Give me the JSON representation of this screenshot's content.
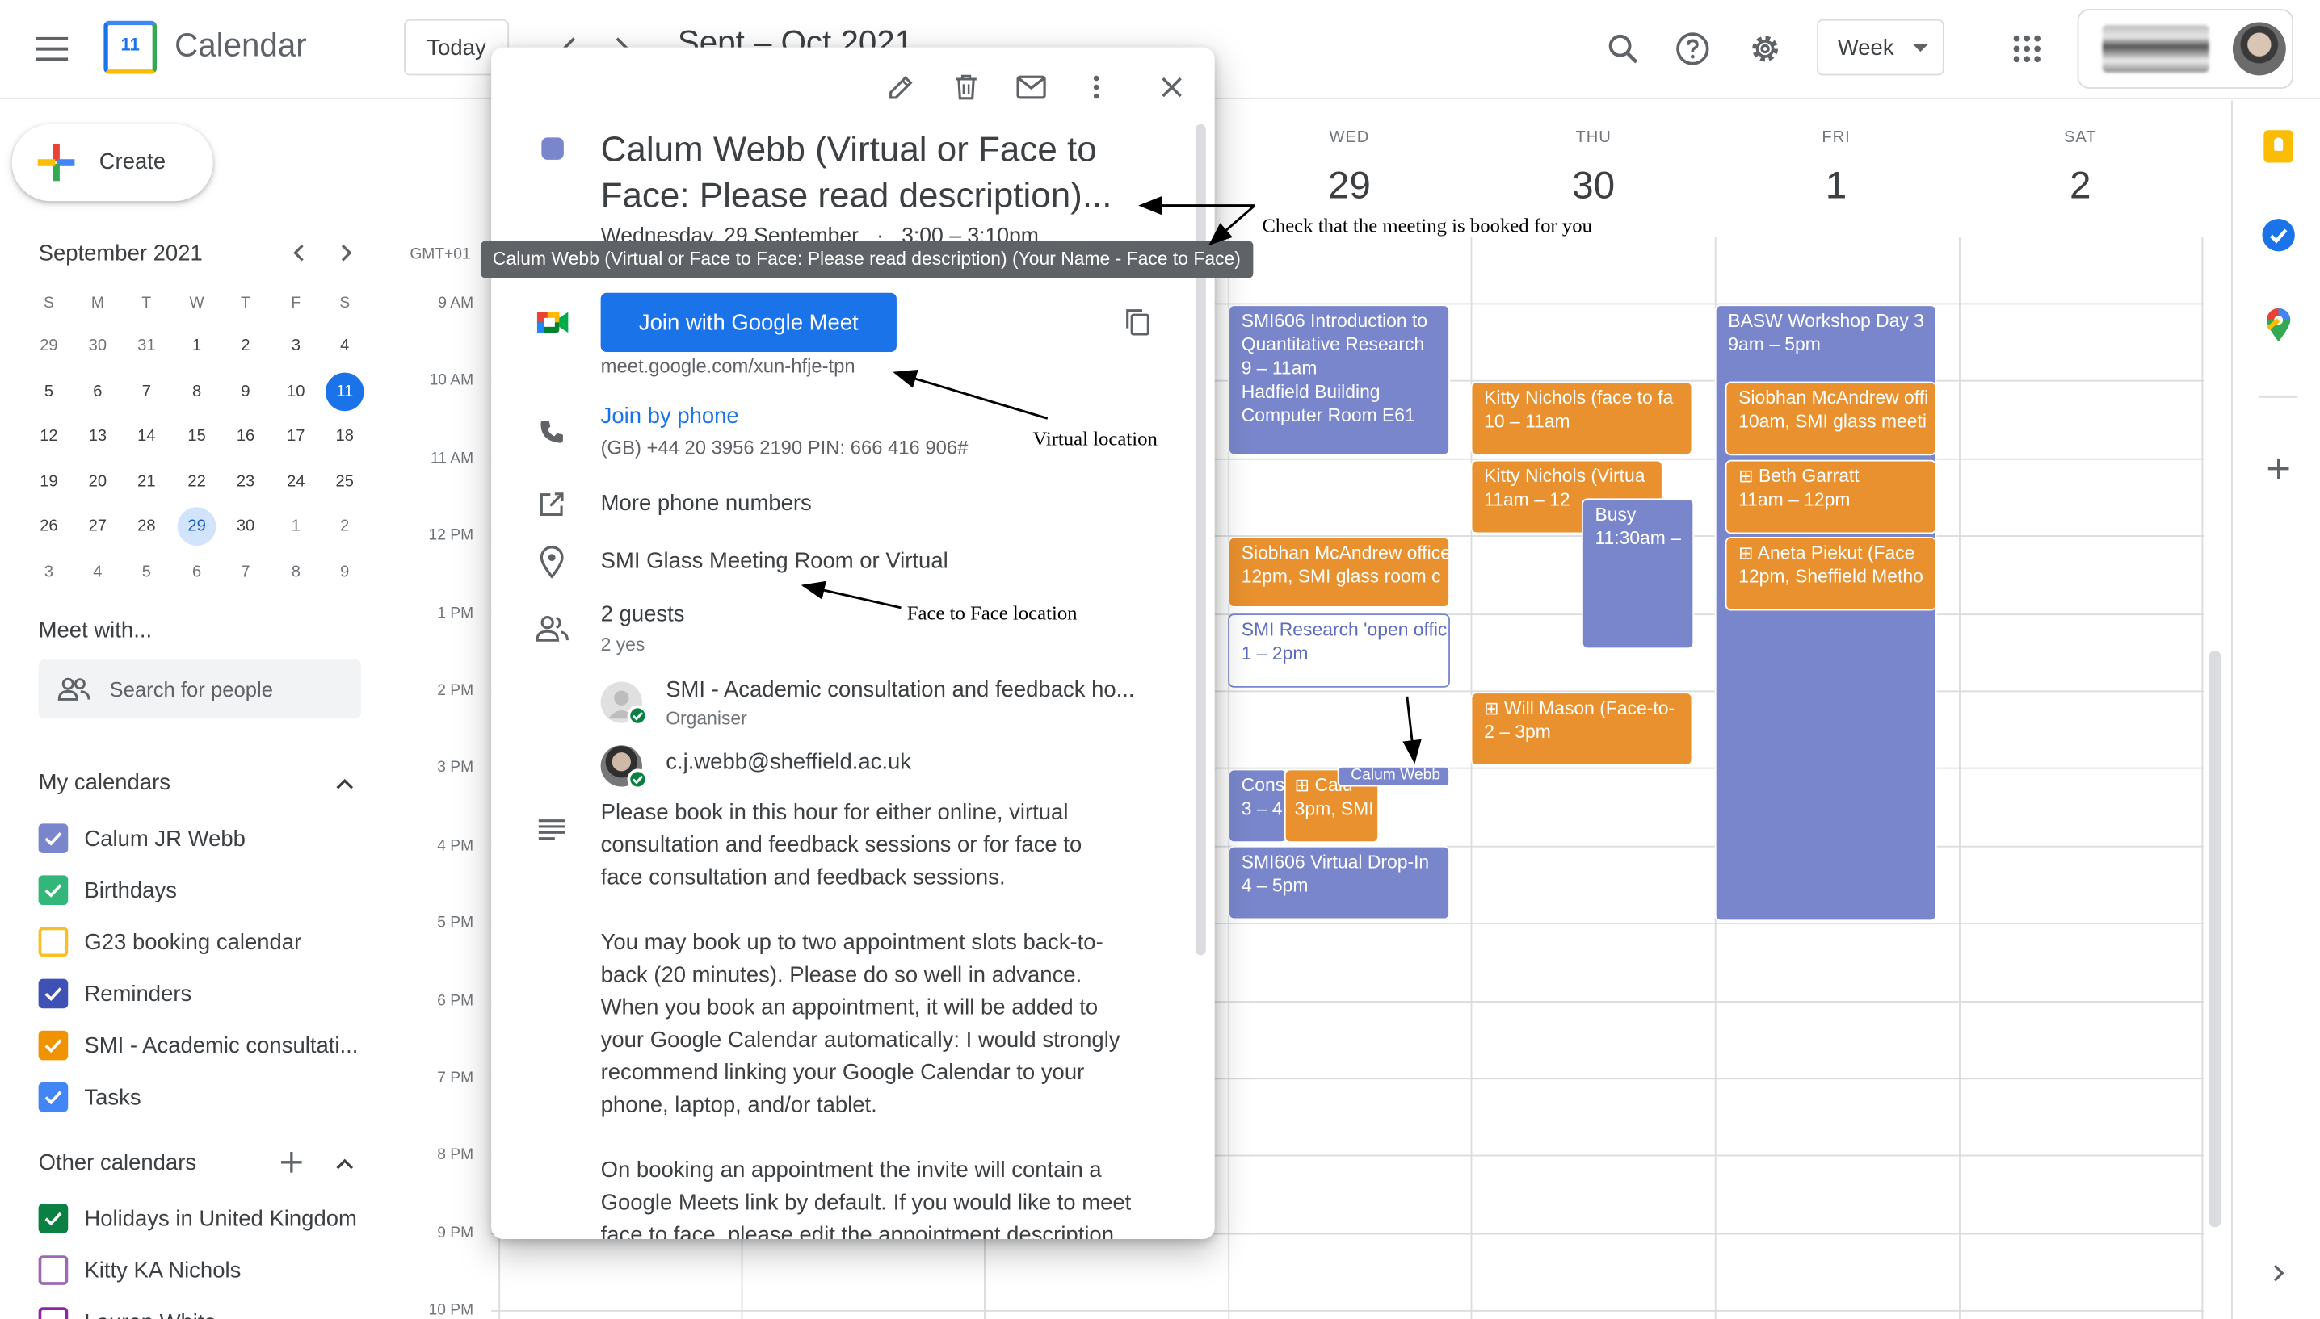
{
  "app": {
    "title": "Calendar",
    "logo_day": "11"
  },
  "header": {
    "today_label": "Today",
    "range_title": "Sept – Oct 2021",
    "view_label": "Week"
  },
  "sidebar": {
    "create_label": "Create",
    "mini_month": "September 2021",
    "weekdays": [
      "S",
      "M",
      "T",
      "W",
      "T",
      "F",
      "S"
    ],
    "weeks": [
      [
        "29",
        "30",
        "31",
        "1",
        "2",
        "3",
        "4"
      ],
      [
        "5",
        "6",
        "7",
        "8",
        "9",
        "10",
        "11"
      ],
      [
        "12",
        "13",
        "14",
        "15",
        "16",
        "17",
        "18"
      ],
      [
        "19",
        "20",
        "21",
        "22",
        "23",
        "24",
        "25"
      ],
      [
        "26",
        "27",
        "28",
        "29",
        "30",
        "1",
        "2"
      ],
      [
        "3",
        "4",
        "5",
        "6",
        "7",
        "8",
        "9"
      ]
    ],
    "today_date": "11",
    "selected_date": "29",
    "meet_with": "Meet with...",
    "search_people_placeholder": "Search for people",
    "my_calendars_label": "My calendars",
    "my_calendars": [
      {
        "name": "Calum JR Webb",
        "color": "#7986cb",
        "checked": true
      },
      {
        "name": "Birthdays",
        "color": "#33b679",
        "checked": true
      },
      {
        "name": "G23 booking calendar",
        "color": "#f6bf26",
        "checked": false
      },
      {
        "name": "Reminders",
        "color": "#3f51b5",
        "checked": true
      },
      {
        "name": "SMI - Academic consultati...",
        "color": "#f09300",
        "checked": true
      },
      {
        "name": "Tasks",
        "color": "#4285f4",
        "checked": true
      }
    ],
    "other_calendars_label": "Other calendars",
    "other_calendars": [
      {
        "name": "Holidays in United Kingdom",
        "color": "#0b8043",
        "checked": true
      },
      {
        "name": "Kitty KA Nichols",
        "color": "#9e69af",
        "checked": false
      },
      {
        "name": "Lauren White",
        "color": "#8e24aa",
        "checked": false
      }
    ]
  },
  "grid": {
    "timezone": "GMT+01",
    "hours": [
      "9 AM",
      "10 AM",
      "11 AM",
      "12 PM",
      "1 PM",
      "2 PM",
      "3 PM",
      "4 PM",
      "5 PM",
      "6 PM",
      "7 PM",
      "8 PM",
      "9 PM",
      "10 PM"
    ],
    "days": [
      {
        "name": "WED",
        "date": "29"
      },
      {
        "name": "THU",
        "date": "30"
      },
      {
        "name": "FRI",
        "date": "1"
      },
      {
        "name": "SAT",
        "date": "2"
      }
    ]
  },
  "events": {
    "wed1": {
      "title": "SMI606 Introduction to",
      "l2": "Quantitative Research",
      "l3": "9 – 11am",
      "l4": "Hadfield Building",
      "l5": "Computer Room E61"
    },
    "wed2": {
      "title": "Siobhan McAndrew office",
      "l2": "12pm, SMI glass room c"
    },
    "wed3": {
      "title": "SMI Research 'open office",
      "l2": "1 – 2pm"
    },
    "wed4": {
      "title": "Cons",
      "l2": "3 – 4"
    },
    "wed5": {
      "title": "Calu",
      "l2": "3pm, SMI"
    },
    "wed6": {
      "title": "Calum Webb"
    },
    "wed7": {
      "title": "SMI606 Virtual Drop-In",
      "l2": "4 – 5pm"
    },
    "thu1": {
      "title": "Kitty Nichols (face to fa",
      "l2": "10 – 11am"
    },
    "thu2": {
      "title": "Kitty Nichols (Virtua",
      "l2": "11am – 12"
    },
    "thu3": {
      "title": "Busy",
      "l2": "11:30am –"
    },
    "thu4": {
      "title": "Will Mason (Face-to-",
      "l2": "2 – 3pm"
    },
    "fri1": {
      "title": "BASW Workshop Day 3",
      "l2": "9am – 5pm"
    },
    "fri2": {
      "title": "Siobhan McAndrew offi",
      "l2": "10am, SMI glass meeti"
    },
    "fri3": {
      "title": "Beth Garratt",
      "l2": "11am – 12pm"
    },
    "fri4": {
      "title": "Aneta Piekut (Face",
      "l2": "12pm, Sheffield Metho"
    }
  },
  "popup": {
    "title_line1": "Calum Webb (Virtual or Face to",
    "title_line2": "Face: Please read description)...",
    "date_line": "Wednesday, 29 September   ·   3:00 – 3:10pm",
    "tooltip": "Calum Webb (Virtual or Face to Face: Please read description) (Your Name - Face to Face)",
    "join_meet_label": "Join with Google Meet",
    "meet_link": "meet.google.com/xun-hfje-tpn",
    "join_phone_label": "Join by phone",
    "phone_details": "(GB) +44 20 3956 2190 PIN: 666 416 906#",
    "more_numbers": "More phone numbers",
    "location": "SMI Glass Meeting Room or Virtual",
    "guests_count": "2 guests",
    "guests_yes": "2 yes",
    "guest1_name": "SMI - Academic consultation and feedback ho...",
    "guest1_role": "Organiser",
    "guest2_name": "c.j.webb@sheffield.ac.uk",
    "desc_p1": [
      "Please book in this hour for either online, virtual",
      "consultation and feedback sessions or for face to",
      "face consultation and feedback sessions."
    ],
    "desc_p2": [
      "You may book up to two appointment slots back-to-",
      "back (20 minutes). Please do so well in advance.",
      "When you book an appointment, it will be added to",
      "your Google Calendar automatically: I would strongly",
      "recommend linking your Google Calendar to your",
      "phone, laptop, and/or tablet."
    ],
    "desc_p3": [
      "On booking an appointment the invite will contain a",
      "Google Meets link by default. If you would like to meet",
      "face to face, please edit the appointment description"
    ]
  },
  "annotations": {
    "check_booked": "Check that the meeting is booked for you",
    "virtual_location": "Virtual location",
    "face_location": "Face to Face location"
  },
  "colors": {
    "event_blue": "#7986cb",
    "event_orange": "#e8912e",
    "accent": "#1a73e8"
  }
}
